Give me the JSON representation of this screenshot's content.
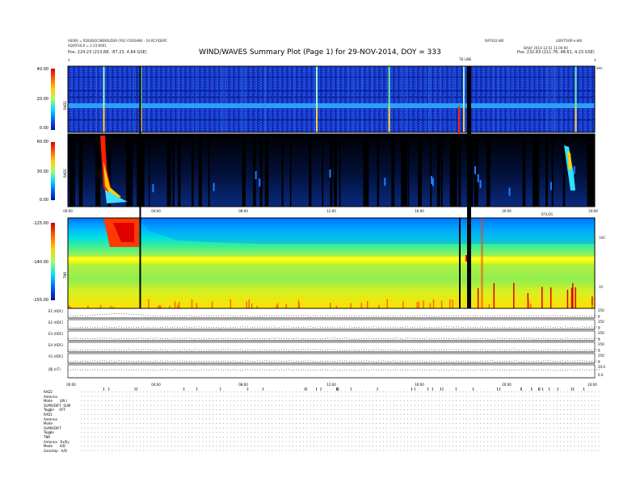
{
  "header": {
    "left_lines": [
      "A0000 = RDO/DOC/NEWS/DSP (YOC-FOOSAW) - 19 RCY/DEPC",
      "AQ/RFSS-0 = 1-23-0001"
    ],
    "left_pos": "Pos:   224.23 (213.68, -87.23, 4.84 GSE)",
    "right_top_a": "RATIO/2-W0",
    "right_top_b": "LOR/TOOP-n-W0",
    "right_line2": "DAILY 2014-12-01 11:00:00",
    "right_pos": "Pos:   232.83 (211.76, 48.61, 4.23 GSE)",
    "title": "WIND/WAVES Summary Plot (Page 1) for 29-NOV-2014, DOY = 333",
    "marker_label": "TB LINE",
    "khz_label": "kHz",
    "kev_label": "EF/LOG",
    "v_left": "V",
    "v_right": "V"
  },
  "colors": {
    "background": "#ffffff",
    "deep_blue": "#102cc0",
    "black": "#000000"
  },
  "chart_data": [
    {
      "type": "heatmap",
      "name_label": "RAD2",
      "x_range_hours": [
        0,
        24
      ],
      "y_ticks": [
        "40.00",
        "20.00",
        "0.00"
      ],
      "ylim": [
        0,
        40
      ],
      "bright_bursts_hours": [
        1.6,
        3.3,
        11.3,
        14.6,
        18.0,
        23.1
      ]
    },
    {
      "type": "heatmap",
      "name_label": "RAD1",
      "x_range_hours": [
        0,
        24
      ],
      "y_ticks": [
        "60.00",
        "30.00",
        "0.00"
      ],
      "ylim": [
        0,
        60
      ],
      "x_ticks": [
        "00:00",
        "04:00",
        "08:00",
        "12:00",
        "16:00",
        "20:00",
        "24:00"
      ]
    },
    {
      "type": "heatmap",
      "name_label": "TNR",
      "x_range_hours": [
        0,
        24
      ],
      "y_ticks": [
        "-125.00",
        "-140.00",
        "-155.00"
      ],
      "ylim": [
        -155,
        -125
      ],
      "right_ticks": [
        "100",
        "10"
      ]
    },
    {
      "type": "line",
      "rows": [
        {
          "label": "E1 (ADC)",
          "right": [
            "250",
            "0"
          ]
        },
        {
          "label": "E2 (ADC)",
          "right": [
            "250",
            "0"
          ]
        },
        {
          "label": "E3 (ADC)",
          "right": [
            "250",
            "0"
          ]
        },
        {
          "label": "E4 (ADC)",
          "right": [
            "250",
            "0"
          ]
        },
        {
          "label": "A1 (ADC)",
          "right": [
            "250",
            "0"
          ]
        },
        {
          "label": "|B| (nT)",
          "right": [
            "20.0",
            "0.0"
          ]
        }
      ],
      "x_ticks": [
        "00:00",
        "04:00",
        "08:00",
        "12:00",
        "16:00",
        "20:00",
        "24:00"
      ]
    }
  ],
  "bottom_left": [
    "RAD2",
    "Antenna",
    "Mode       LIN (",
    "SUMX/DIFF  SUM",
    "Toggle     OFF",
    "RAD1",
    "Antenna",
    "Mode",
    "SUMX/DIFF",
    "Toggle",
    "TNR",
    "Antenna   Ex/Ey",
    "Mode       A/D",
    "Gainstep   A/D"
  ]
}
